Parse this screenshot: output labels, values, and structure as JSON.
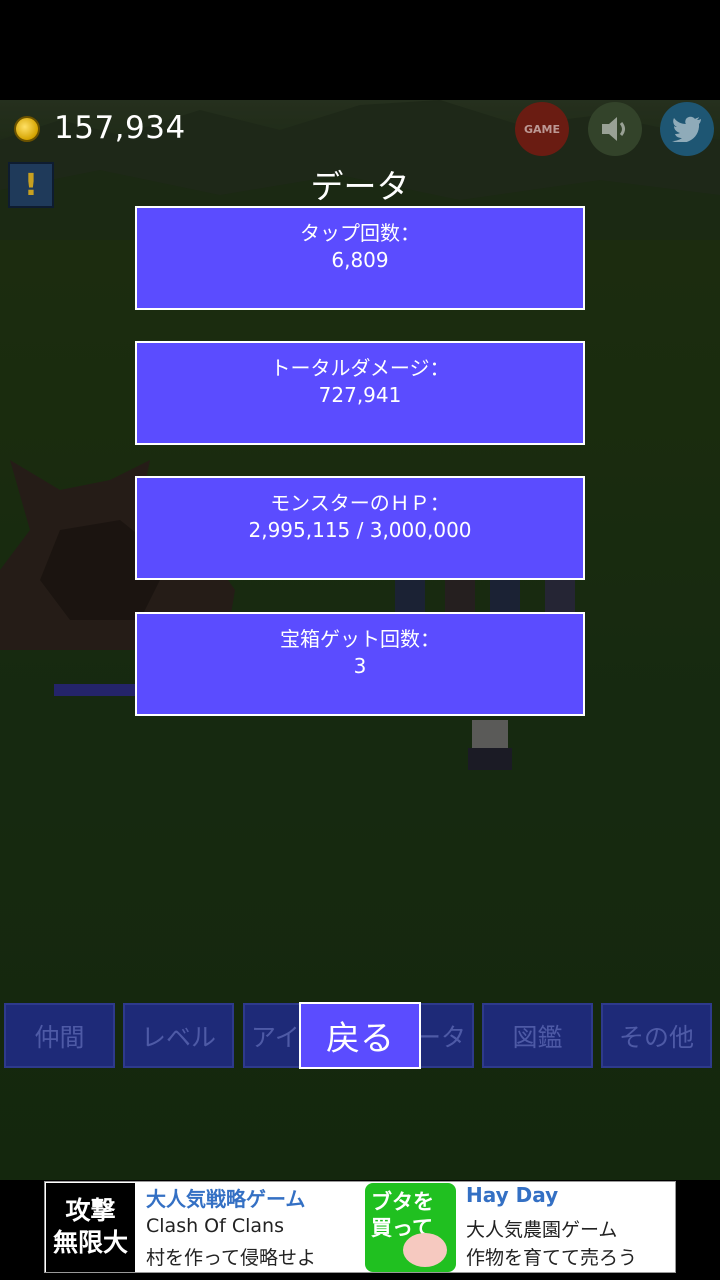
{
  "hud": {
    "coins": "157,934",
    "game_button": "GAME"
  },
  "panel": {
    "title": "データ",
    "stats": [
      {
        "label": "タップ回数：",
        "value": "6,809"
      },
      {
        "label": "トータルダメージ：",
        "value": "727,941"
      },
      {
        "label": "モンスターのＨＰ：",
        "value": "2,995,115 / 3,000,000"
      },
      {
        "label": "宝箱ゲット回数：",
        "value": "3"
      }
    ],
    "back_label": "戻る"
  },
  "tabs": [
    "仲間",
    "レベル",
    "アイテム",
    "データ",
    "図鑑",
    "その他"
  ],
  "ad": {
    "left": {
      "icon_text_1": "攻撃",
      "icon_text_2": "無限大",
      "title": "大人気戦略ゲーム",
      "line1": "Clash Of Clans",
      "line2": "村を作って侵略せよ"
    },
    "right": {
      "icon_text_1": "ブタを",
      "icon_text_2": "買って",
      "title": "Hay Day",
      "line1": "大人気農園ゲーム",
      "line2": "作物を育てて売ろう"
    }
  },
  "colors": {
    "panel": "#5b4cff",
    "panel_border": "#ffffff",
    "tab_dim": "#1e2a78",
    "grass": "#2b4418"
  }
}
